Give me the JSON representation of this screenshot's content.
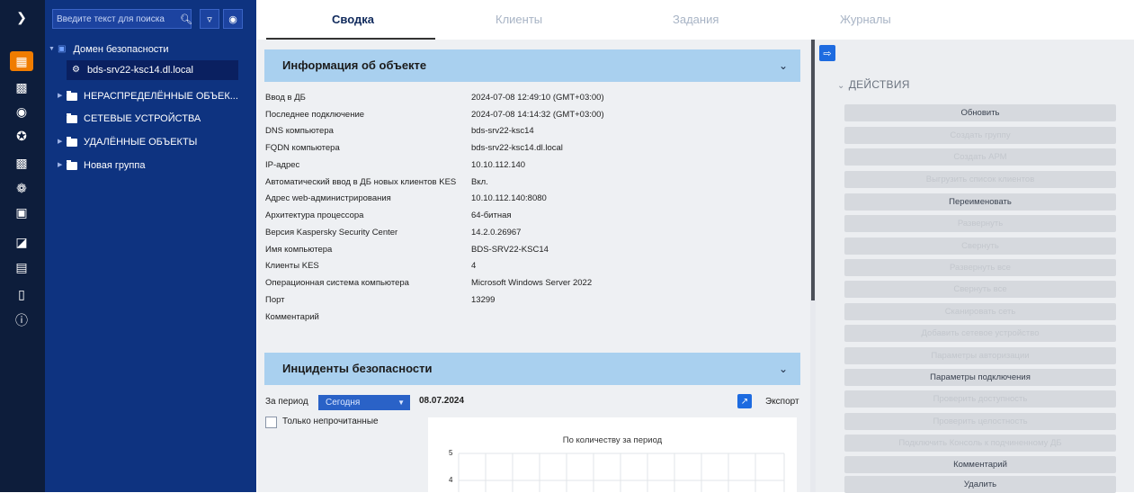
{
  "search": {
    "placeholder": "Введите текст для поиска"
  },
  "tree": [
    {
      "label": "Домен безопасности",
      "type": "domain"
    },
    {
      "label": "bds-srv22-ksc14.dl.local",
      "type": "server"
    },
    {
      "label": "НЕРАСПРЕДЕЛЁННЫЕ ОБЪЕК...",
      "type": "folder"
    },
    {
      "label": "СЕТЕВЫЕ УСТРОЙСТВА",
      "type": "folder"
    },
    {
      "label": "УДАЛЁННЫЕ ОБЪЕКТЫ",
      "type": "folder"
    },
    {
      "label": "Новая группа",
      "type": "folder"
    }
  ],
  "tabs": [
    "Сводка",
    "Клиенты",
    "Задания",
    "Журналы"
  ],
  "info": {
    "title": "Информация об объекте",
    "rows": [
      {
        "label": "Ввод в ДБ",
        "value": "2024-07-08 12:49:10 (GMT+03:00)"
      },
      {
        "label": "Последнее подключение",
        "value": "2024-07-08 14:14:32 (GMT+03:00)"
      },
      {
        "label": "DNS компьютера",
        "value": "bds-srv22-ksc14"
      },
      {
        "label": "FQDN компьютера",
        "value": "bds-srv22-ksc14.dl.local"
      },
      {
        "label": "IP-адрес",
        "value": "10.10.112.140"
      },
      {
        "label": "Автоматический ввод в ДБ новых клиентов KES",
        "value": "Вкл."
      },
      {
        "label": "Адрес web-администрирования",
        "value": "10.10.112.140:8080"
      },
      {
        "label": "Архитектура процессора",
        "value": "64-битная"
      },
      {
        "label": "Версия Kaspersky Security Center",
        "value": "14.2.0.26967"
      },
      {
        "label": "Имя компьютера",
        "value": "BDS-SRV22-KSC14"
      },
      {
        "label": "Клиенты KES",
        "value": "4"
      },
      {
        "label": "Операционная система компьютера",
        "value": "Microsoft Windows Server 2022"
      },
      {
        "label": "Порт",
        "value": "13299"
      },
      {
        "label": "Комментарий",
        "value": ""
      }
    ]
  },
  "incidents": {
    "title": "Инциденты безопасности",
    "period_label": "За период",
    "period_value": "Сегодня",
    "date": "08.07.2024",
    "export_label": "Экспорт",
    "unread_label": "Только непрочитанные",
    "chart_title": "По количеству за период",
    "y_ticks": [
      "5",
      "4"
    ]
  },
  "actions": {
    "title": "ДЕЙСТВИЯ",
    "items": [
      {
        "label": "Обновить",
        "enabled": true
      },
      {
        "label": "Создать группу",
        "enabled": false
      },
      {
        "label": "Создать АРМ",
        "enabled": false
      },
      {
        "label": "Выгрузить список клиентов",
        "enabled": false
      },
      {
        "label": "Переименовать",
        "enabled": true
      },
      {
        "label": "Развернуть",
        "enabled": false
      },
      {
        "label": "Свернуть",
        "enabled": false
      },
      {
        "label": "Развернуть все",
        "enabled": false
      },
      {
        "label": "Свернуть все",
        "enabled": false
      },
      {
        "label": "Сканировать сеть",
        "enabled": false
      },
      {
        "label": "Добавить сетевое устройство",
        "enabled": false
      },
      {
        "label": "Параметры авторизации",
        "enabled": false
      },
      {
        "label": "Параметры подключения",
        "enabled": true
      },
      {
        "label": "Проверить доступность",
        "enabled": false
      },
      {
        "label": "Проверить целостность",
        "enabled": false
      },
      {
        "label": "Подключить Консоль к подчиненному ДБ",
        "enabled": false
      },
      {
        "label": "Комментарий",
        "enabled": true
      },
      {
        "label": "Удалить",
        "enabled": true
      }
    ]
  },
  "colors": {
    "rail": "#0d1d3b",
    "tree": "#0e3380",
    "accent": "#f07c00",
    "section_header": "#a9d0ef"
  }
}
